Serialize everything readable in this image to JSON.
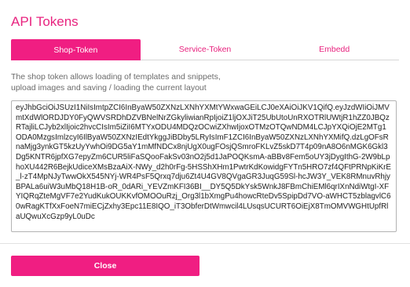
{
  "dialog": {
    "title": "API Tokens"
  },
  "tabs": [
    {
      "label": "Shop-Token",
      "active": true
    },
    {
      "label": "Service-Token",
      "active": false
    },
    {
      "label": "Embedd",
      "active": false
    }
  ],
  "shop_token": {
    "description": "The shop token allows loading of templates and snippets, upload images and saving / loading the current layout",
    "token_value": "eyJhbGciOiJSUzI1NiIsImtpZCI6InByaW50ZXNzLXNhYXMtYWxwaGEiLCJ0eXAiOiJKV1QifQ.eyJzdWIiOiJMVmtXdWlORDJDY0FyQWVSRDhDZVBNelNrZGkyliwianRpIjoiZ1ljOXJiT25UbUtoUnRXOTRlUWtjR1hZZ0JBQzRTajliLCJyb2xlIjoic2hvcCIsIm5iZiI6MTYxODU4MDQzOCwiZXhwIjoxOTMzOTQwNDM4LCJpYXQiOjE2MTg1ODA0MzgsImlzcyI6IlByaW50ZXNzIEdtYkggJiBDby5LRyIsImF1ZCI6InByaW50ZXNzLXNhYXMifQ.dzLgOFsRnaMjg3ynkGT5kzUyYwhOi9DG5aY1mMfNDCx8njUgX0ugFOsjQSmroFKLvZ5skD7T4p09nA8O6nMGK6Gkl3Dg5KNTR6jpfXG7epyZm6CUR5liFaSQooFakSv03nO2j5d1JaPOQKsmA-aBBv8Fem5oUY3jDygIthG-2W9bLphoXU442R6BejkUdiceXMsBzaAiX-NWy_d2h0rFg-5HSShXHm1PwtrKdKowidgFYTn5HRO7zf4QFtPRNpKiKrE_l-zT4MpNJyTwwOkX545NYj-WR4PsF5Qrxq7dju6Zt4U4GV8QVgaGR3JuqG59Sl-hcJW3Y_VEK8RMnuvRhjyBPALa6uiW3uMbQ18H1B-oR_0dARi_YEVZmKFI36BI__DY5Q5DkYsk5WnkJ8FBmChiEMl6qrIXnNdiWtgI-XFYIQRqZteMgVF7e2YudKukOUKKvfOMOOuRzj_Org3l1bXmgPu4howcRteDv5SpipDd7VO-aWHCT5zblagvlC60wRagKTfXxFoeN7miECjZxhy3Epc11E8IQO_iT3ObferDtWmwcil4LUsqsUCURT6OiEjX8TmOMVWGHtUpfRlaUQwuXcGzp9yL0uDc"
  },
  "footer": {
    "close_label": "Close"
  }
}
